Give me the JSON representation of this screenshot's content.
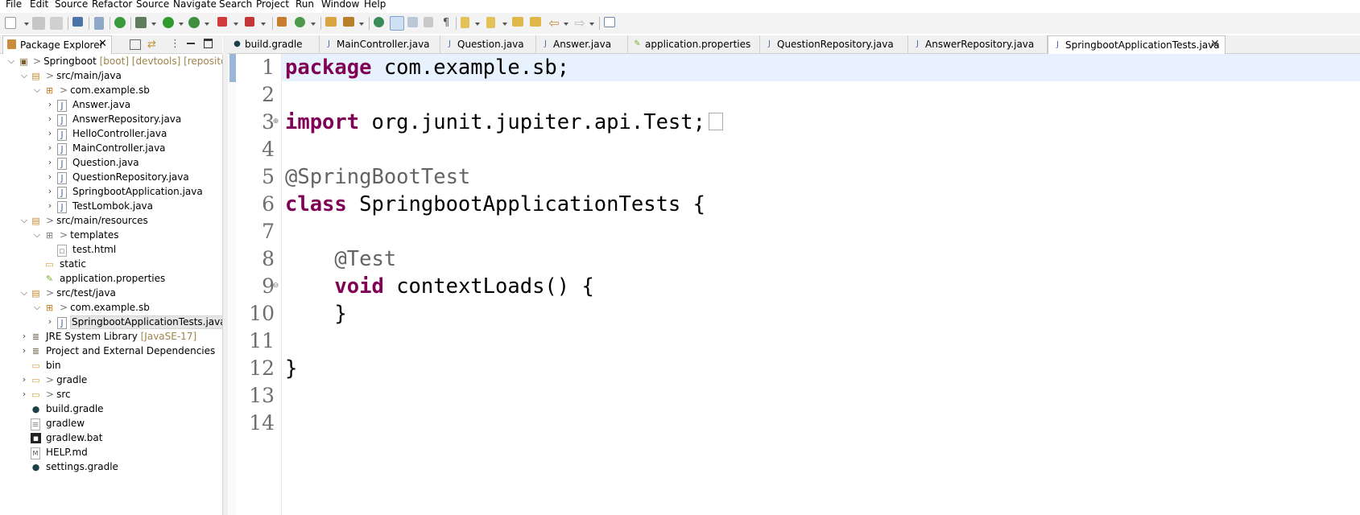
{
  "menu": [
    "File",
    "Edit",
    "Source",
    "Refactor",
    "Source",
    "Navigate",
    "Search",
    "Project",
    "Run",
    "Window",
    "Help"
  ],
  "left_view": {
    "tab_label": "Package Explorer",
    "tree": [
      {
        "label": "Springboot",
        "deco": "[boot] [devtools] [repository"
      },
      {
        "label": "src/main/java"
      },
      {
        "label": "com.example.sb"
      },
      {
        "label": "Answer.java"
      },
      {
        "label": "AnswerRepository.java"
      },
      {
        "label": "HelloController.java"
      },
      {
        "label": "MainController.java"
      },
      {
        "label": "Question.java"
      },
      {
        "label": "QuestionRepository.java"
      },
      {
        "label": "SpringbootApplication.java"
      },
      {
        "label": "TestLombok.java"
      },
      {
        "label": "src/main/resources"
      },
      {
        "label": "templates"
      },
      {
        "label": "test.html"
      },
      {
        "label": "static"
      },
      {
        "label": "application.properties"
      },
      {
        "label": "src/test/java"
      },
      {
        "label": "com.example.sb"
      },
      {
        "label": "SpringbootApplicationTests.java"
      },
      {
        "label": "JRE System Library",
        "deco": "[JavaSE-17]"
      },
      {
        "label": "Project and External Dependencies"
      },
      {
        "label": "bin"
      },
      {
        "label": "gradle"
      },
      {
        "label": "src"
      },
      {
        "label": "build.gradle"
      },
      {
        "label": "gradlew"
      },
      {
        "label": "gradlew.bat"
      },
      {
        "label": "HELP.md"
      },
      {
        "label": "settings.gradle"
      }
    ]
  },
  "editor_tabs": [
    "build.gradle",
    "MainController.java",
    "Question.java",
    "Answer.java",
    "application.properties",
    "QuestionRepository.java",
    "AnswerRepository.java",
    "SpringbootApplicationTests.java"
  ],
  "active_tab": "SpringbootApplicationTests.java",
  "line_numbers": [
    "1",
    "2",
    "3",
    "4",
    "5",
    "6",
    "7",
    "8",
    "9",
    "10",
    "11",
    "12",
    "13",
    "14"
  ],
  "code": {
    "l1_kw": "package",
    "l1_rest": " com.example.sb;",
    "l3_kw": "import",
    "l3_rest": " org.junit.jupiter.api.Test;",
    "l6_ann": "@SpringBootTest",
    "l7_kw": "class",
    "l7_rest": " SpringbootApplicationTests {",
    "l9_ann": "    @Test",
    "l10_indent": "    ",
    "l10_kw": "void",
    "l10_rest": " contextLoads() {",
    "l11": "    }",
    "l13": "}"
  },
  "colors": {
    "keyword": "#7f0055",
    "annotation": "#646464",
    "current_line": "#e8f2fe"
  },
  "icons": [
    "new-icon",
    "save-icon",
    "print-icon",
    "debug-icon",
    "run-icon",
    "search-icon",
    "package-icon",
    "java-file-icon",
    "folder-icon",
    "library-icon",
    "gradle-icon"
  ]
}
